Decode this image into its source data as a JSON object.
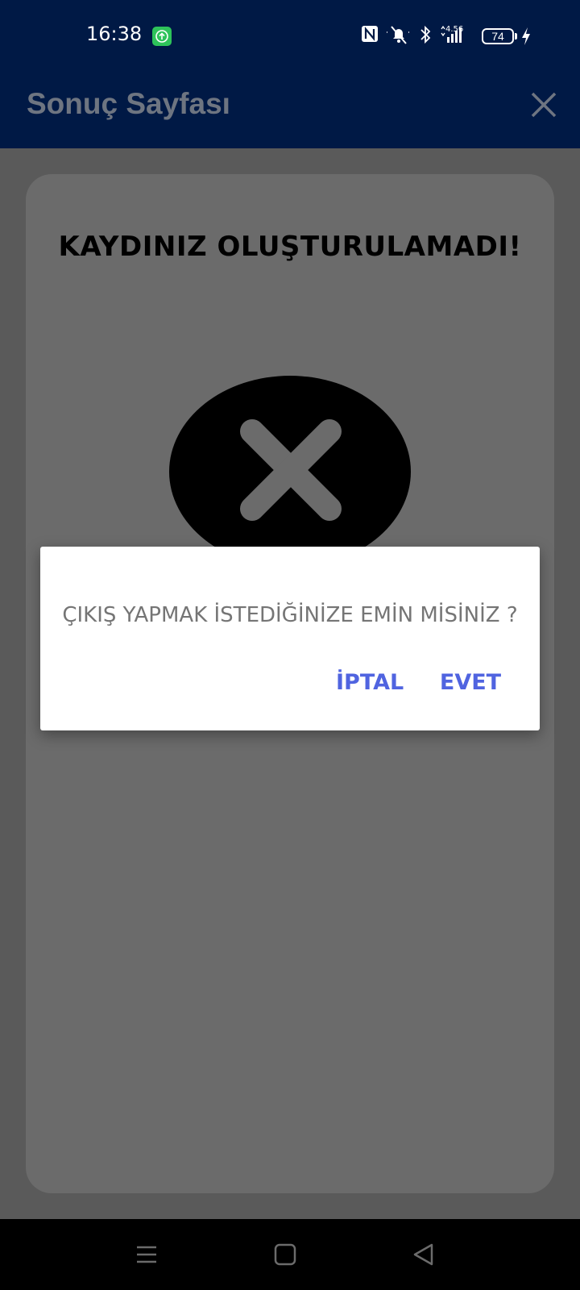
{
  "status_bar": {
    "time": "16:38",
    "net_speed_top": "4.56",
    "battery_level": "74",
    "icons": [
      "upload-badge-icon",
      "nfc-icon",
      "silent-icon",
      "bluetooth-icon",
      "signal-icon",
      "battery-icon",
      "charging-icon"
    ]
  },
  "app_bar": {
    "title": "Sonuç Sayfası",
    "close_icon": "close-icon"
  },
  "result": {
    "title": "KAYDINIZ OLUŞTURULAMADI!",
    "icon": "error-x-icon"
  },
  "dialog": {
    "message": "ÇIKIŞ YAPMAK İSTEDİĞİNİZE EMİN MİSİNİZ ?",
    "cancel_label": "İPTAL",
    "confirm_label": "EVET",
    "accent_color": "#5064e0"
  },
  "nav_bar": {
    "icons": [
      "menu-icon",
      "home-icon",
      "back-icon"
    ]
  },
  "colors": {
    "app_bar": "#001945",
    "scrim": "#5a5a5a",
    "card": "#6b6b6b"
  }
}
